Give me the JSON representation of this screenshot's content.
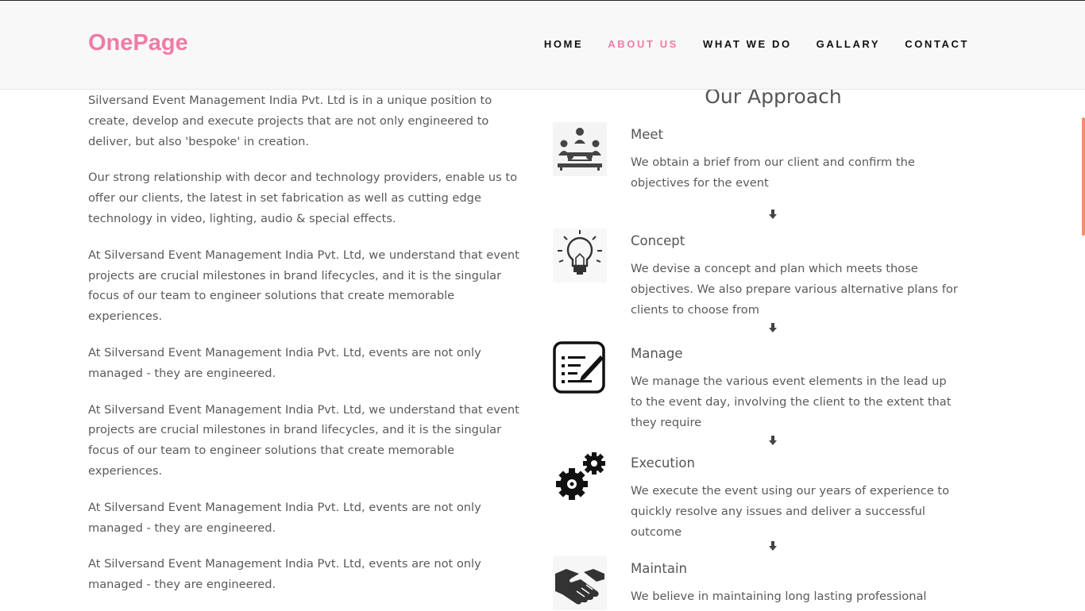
{
  "brand": {
    "name": "OnePage",
    "color": "#f07ba6"
  },
  "nav": {
    "items": [
      {
        "label": "HOME",
        "active": false
      },
      {
        "label": "ABOUT US",
        "active": true
      },
      {
        "label": "WHAT WE DO",
        "active": false
      },
      {
        "label": "GALLARY",
        "active": false
      },
      {
        "label": "CONTACT",
        "active": false
      }
    ]
  },
  "about": {
    "paragraphs": [
      "Silversand Event Management India Pvt. Ltd is in a unique position to create, develop and execute projects that are not only engineered to deliver, but also 'bespoke' in creation.",
      "Our strong relationship with decor and technology providers, enable us to offer our clients, the latest in set fabrication as well as cutting edge technology in video, lighting, audio & special effects.",
      "At Silversand Event Management India Pvt. Ltd, we understand that event projects are crucial milestones in brand lifecycles, and it is the singular focus of our team to engineer solutions that create memorable experiences.",
      "At Silversand Event Management India Pvt. Ltd, events are not only managed - they are engineered.",
      "At Silversand Event Management India Pvt. Ltd, we understand that event projects are crucial milestones in brand lifecycles, and it is the singular focus of our team to engineer solutions that create memorable experiences.",
      "At Silversand Event Management India Pvt. Ltd, events are not only managed - they are engineered.",
      "At Silversand Event Management India Pvt. Ltd, events are not only managed - they are engineered."
    ]
  },
  "approach": {
    "title": "Our Approach",
    "steps": [
      {
        "title": "Meet",
        "icon": "meeting-table-icon",
        "desc": "We obtain a brief from our client and confirm the objectives for the event"
      },
      {
        "title": "Concept",
        "icon": "lightbulb-icon",
        "desc": "We devise a concept and plan which meets those objectives. We also prepare various alternative plans for clients to choose from"
      },
      {
        "title": "Manage",
        "icon": "checklist-edit-icon",
        "desc": "We manage the various event elements in the lead up to the event day, involving the client to the extent that they require"
      },
      {
        "title": "Execution",
        "icon": "gears-icon",
        "desc": "We execute the event using our years of experience to quickly resolve any issues and deliver a successful outcome"
      },
      {
        "title": "Maintain",
        "icon": "handshake-icon",
        "desc": "We believe in maintaining long lasting professional"
      }
    ]
  },
  "colors": {
    "accent": "#f07ba6",
    "scrollbar": "#f0906a",
    "text": "#5a5a5a"
  }
}
